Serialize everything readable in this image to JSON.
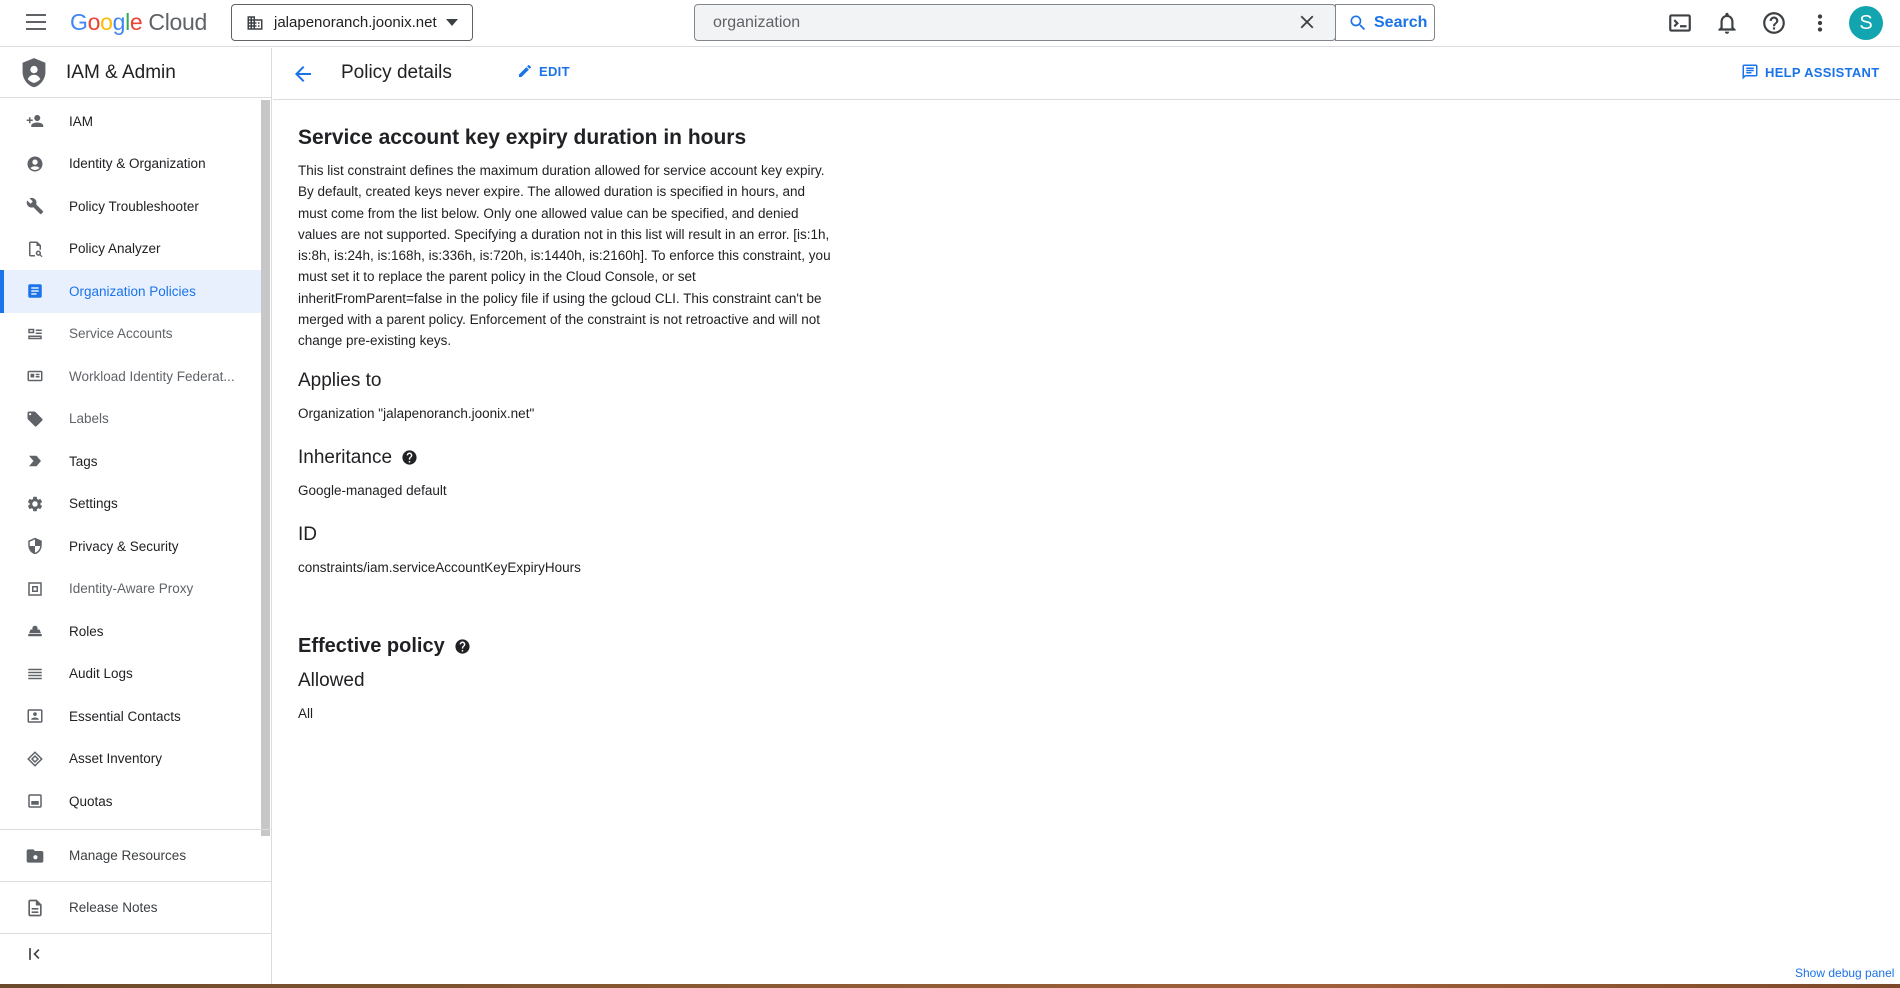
{
  "header": {
    "logo_google": [
      "G",
      "o",
      "o",
      "g",
      "l",
      "e"
    ],
    "logo_cloud": "Cloud",
    "project": "jalapenoranch.joonix.net",
    "search_value": "organization",
    "search_button": "Search",
    "avatar_initial": "S"
  },
  "sidebar": {
    "title": "IAM & Admin",
    "items": [
      {
        "label": "IAM",
        "icon": "person-add-icon",
        "dim": false
      },
      {
        "label": "Identity & Organization",
        "icon": "account-circle-icon",
        "dim": false
      },
      {
        "label": "Policy Troubleshooter",
        "icon": "wrench-icon",
        "dim": false
      },
      {
        "label": "Policy Analyzer",
        "icon": "policy-doc-icon",
        "dim": false
      },
      {
        "label": "Organization Policies",
        "icon": "list-doc-icon",
        "dim": false,
        "active": true
      },
      {
        "label": "Service Accounts",
        "icon": "service-account-icon",
        "dim": true
      },
      {
        "label": "Workload Identity Federat...",
        "icon": "id-card-icon",
        "dim": true
      },
      {
        "label": "Labels",
        "icon": "label-icon",
        "dim": true
      },
      {
        "label": "Tags",
        "icon": "tag-icon",
        "dim": false
      },
      {
        "label": "Settings",
        "icon": "gear-icon",
        "dim": false
      },
      {
        "label": "Privacy & Security",
        "icon": "shield-icon",
        "dim": false
      },
      {
        "label": "Identity-Aware Proxy",
        "icon": "proxy-icon",
        "dim": true
      },
      {
        "label": "Roles",
        "icon": "roles-icon",
        "dim": false
      },
      {
        "label": "Audit Logs",
        "icon": "list-icon",
        "dim": false
      },
      {
        "label": "Essential Contacts",
        "icon": "contacts-icon",
        "dim": false
      },
      {
        "label": "Asset Inventory",
        "icon": "diamond-icon",
        "dim": false
      },
      {
        "label": "Quotas",
        "icon": "quota-icon",
        "dim": false
      }
    ],
    "manage_resources": "Manage Resources",
    "release_notes": "Release Notes"
  },
  "main": {
    "page_title": "Policy details",
    "edit_label": "EDIT",
    "help_label": "HELP ASSISTANT",
    "constraint_title": "Service account key expiry duration in hours",
    "description_lines": [
      "This list constraint defines the maximum duration allowed for service account key expiry.",
      "By default, created keys never expire. The allowed duration is specified in hours, and",
      "must come from the list below. Only one allowed value can be specified, and denied",
      "values are not supported. Specifying a duration not in this list will result in an error. [is:1h,",
      "is:8h, is:24h, is:168h, is:336h, is:720h, is:1440h, is:2160h]. To enforce this constraint, you",
      "must set it to replace the parent policy in the Cloud Console, or set",
      "inheritFromParent=false in the policy file if using the gcloud CLI. This constraint can't be",
      "merged with a parent policy. Enforcement of the constraint is not retroactive and will not",
      "change pre-existing keys."
    ],
    "applies_to_label": "Applies to",
    "applies_to_value": "Organization \"jalapenoranch.joonix.net\"",
    "inheritance_label": "Inheritance",
    "inheritance_value": "Google-managed default",
    "id_label": "ID",
    "id_value": "constraints/iam.serviceAccountKeyExpiryHours",
    "effective_policy_label": "Effective policy",
    "allowed_label": "Allowed",
    "allowed_value": "All"
  },
  "debug_link": "Show debug panel",
  "colors": {
    "accent": "#1a73e8",
    "active_bg": "#e8f0fe",
    "avatar": "#12a4af"
  }
}
